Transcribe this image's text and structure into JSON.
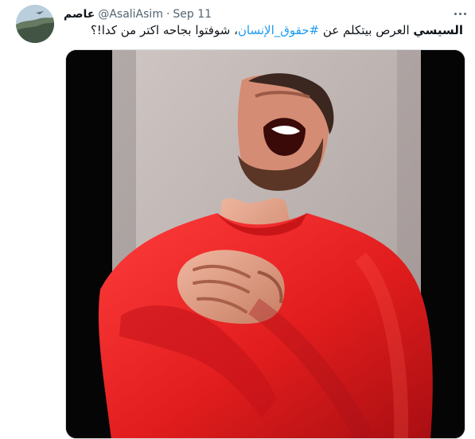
{
  "tweet": {
    "display_name": "عاصم",
    "handle": "@AsaliAsim",
    "separator": "·",
    "date": "Sep 11",
    "text_parts": {
      "bold": "السيسي",
      "middle": " العرص بيتكلم عن ",
      "hashtag": "#حقوق_الإنسان",
      "end": "، شوفتوا بجاحه اكتر من كدا!؟"
    }
  },
  "icons": {
    "more": "more-horizontal-icon",
    "avatar": "avatar-image"
  },
  "colors": {
    "hashtag": "#1d9bf0",
    "secondary_text": "#536471",
    "sweater": "#e51f1f"
  }
}
